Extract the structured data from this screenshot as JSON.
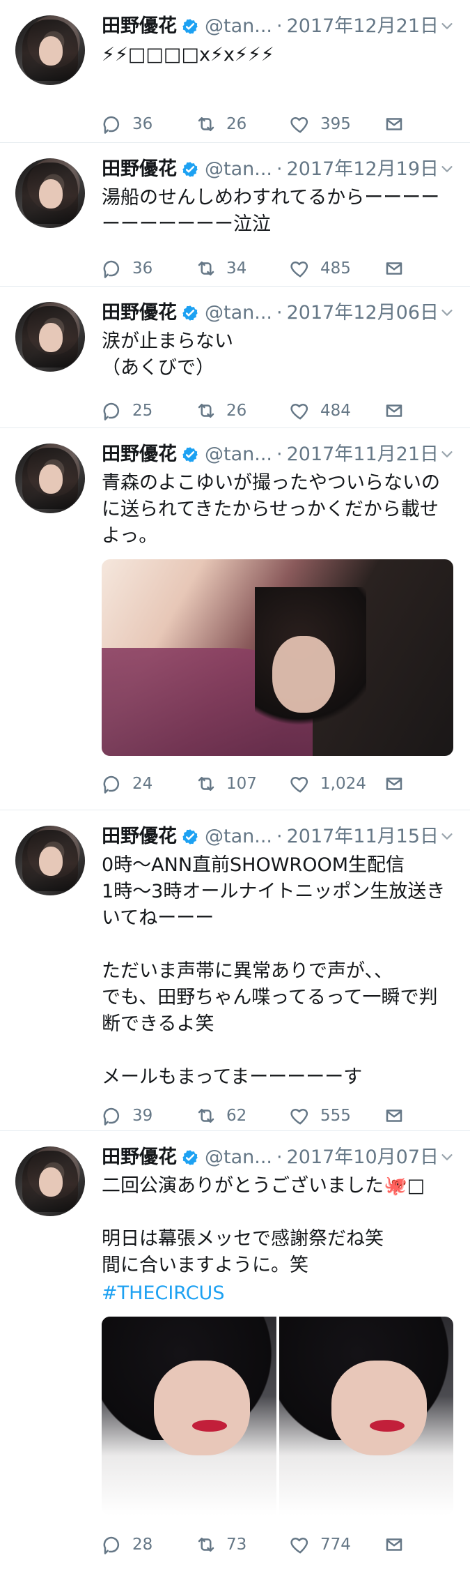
{
  "tweets": [
    {
      "name": "田野優花",
      "handle": "@tan...",
      "date": "2017年12月21日",
      "text": "⚡⚡□□□□x⚡x⚡⚡⚡",
      "replies": "36",
      "retweets": "26",
      "likes": "395"
    },
    {
      "name": "田野優花",
      "handle": "@tan...",
      "date": "2017年12月19日",
      "text": "湯船のせんしめわすれてるからーーーーーーーーーーー泣泣",
      "replies": "36",
      "retweets": "34",
      "likes": "485"
    },
    {
      "name": "田野優花",
      "handle": "@tan...",
      "date": "2017年12月06日",
      "text": "涙が止まらない\n（あくびで）",
      "replies": "25",
      "retweets": "26",
      "likes": "484"
    },
    {
      "name": "田野優花",
      "handle": "@tan...",
      "date": "2017年11月21日",
      "text": "青森のよこゆいが撮ったやついらないのに送られてきたからせっかくだから載せよっ。",
      "replies": "24",
      "retweets": "107",
      "likes": "1,024"
    },
    {
      "name": "田野優花",
      "handle": "@tan...",
      "date": "2017年11月15日",
      "text": "0時〜ANN直前SHOWROOM生配信\n1時〜3時オールナイトニッポン生放送きいてねーーー\n\nただいま声帯に異常ありで声が、、\nでも、田野ちゃん喋ってるって一瞬で判断できるよ笑\n\nメールもまってまーーーーーす",
      "replies": "39",
      "retweets": "62",
      "likes": "555"
    },
    {
      "name": "田野優花",
      "handle": "@tan...",
      "date": "2017年10月07日",
      "text": "二回公演ありがとうございました🐙□\n\n明日は幕張メッセで感謝祭だね笑\n間に合いますように。笑",
      "hashtag": "#THECIRCUS",
      "replies": "28",
      "retweets": "73",
      "likes": "774"
    }
  ],
  "colors": {
    "text": "#14171a",
    "secondary": "#657786",
    "link": "#1da1f2",
    "verified": "#1da1f2",
    "divider": "#e6ecf0"
  },
  "icons": {
    "reply": "reply-icon",
    "retweet": "retweet-icon",
    "like": "heart-icon",
    "mail": "mail-icon",
    "verified": "verified-badge-icon",
    "more": "chevron-down-icon"
  }
}
